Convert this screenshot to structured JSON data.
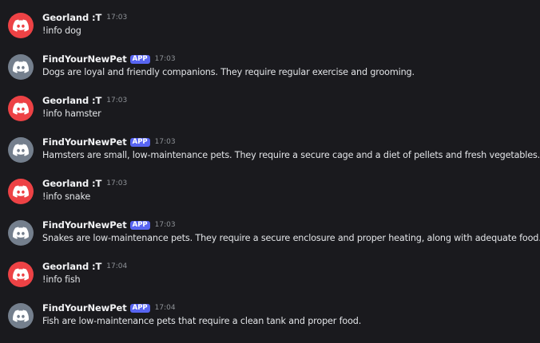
{
  "colors": {
    "user_avatar_bg": "#ed4245",
    "bot_avatar_bg": "#747f8d",
    "app_badge_bg": "#5865f2",
    "background": "#1a1a1e"
  },
  "messages": [
    {
      "author": "Georland :T",
      "avatar": "discord-logo-icon",
      "is_app": false,
      "badge": "",
      "time": "17:03",
      "text": "!info dog"
    },
    {
      "author": "FindYourNewPet",
      "avatar": "discord-logo-icon",
      "is_app": true,
      "badge": "APP",
      "time": "17:03",
      "text": "Dogs are loyal and friendly companions. They require regular exercise and grooming."
    },
    {
      "author": "Georland :T",
      "avatar": "discord-logo-icon",
      "is_app": false,
      "badge": "",
      "time": "17:03",
      "text": "!info hamster"
    },
    {
      "author": "FindYourNewPet",
      "avatar": "discord-logo-icon",
      "is_app": true,
      "badge": "APP",
      "time": "17:03",
      "text": "Hamsters are small, low-maintenance pets. They require a secure cage and a diet of pellets and fresh vegetables."
    },
    {
      "author": "Georland :T",
      "avatar": "discord-logo-icon",
      "is_app": false,
      "badge": "",
      "time": "17:03",
      "text": "!info snake"
    },
    {
      "author": "FindYourNewPet",
      "avatar": "discord-logo-icon",
      "is_app": true,
      "badge": "APP",
      "time": "17:03",
      "text": "Snakes are low-maintenance pets. They require a secure enclosure and proper heating, along with adequate food."
    },
    {
      "author": "Georland :T",
      "avatar": "discord-logo-icon",
      "is_app": false,
      "badge": "",
      "time": "17:04",
      "text": "!info fish"
    },
    {
      "author": "FindYourNewPet",
      "avatar": "discord-logo-icon",
      "is_app": true,
      "badge": "APP",
      "time": "17:04",
      "text": "Fish are low-maintenance pets that require a clean tank and proper food."
    }
  ]
}
